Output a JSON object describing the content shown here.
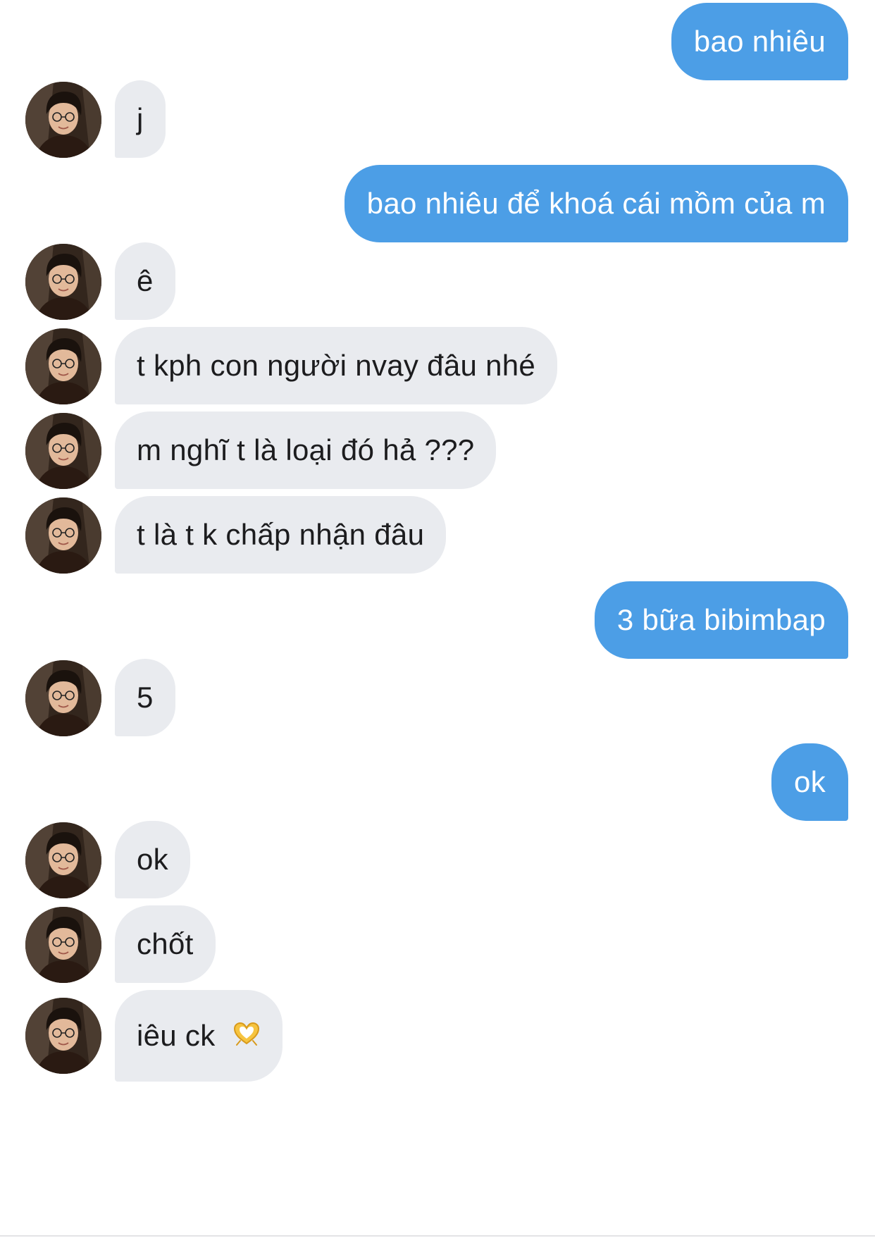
{
  "conversation": {
    "messages": [
      {
        "sender": "me",
        "text": "bao nhiêu"
      },
      {
        "sender": "them",
        "text": "j"
      },
      {
        "sender": "me",
        "text": "bao nhiêu để khoá cái mồm của m"
      },
      {
        "sender": "them",
        "text": "ê"
      },
      {
        "sender": "them",
        "text": "t kph con người nvay đâu nhé"
      },
      {
        "sender": "them",
        "text": "m nghĩ t là loại đó hả ???"
      },
      {
        "sender": "them",
        "text": "t là t k chấp nhận đâu"
      },
      {
        "sender": "me",
        "text": "3 bữa bibimbap"
      },
      {
        "sender": "them",
        "text": "5"
      },
      {
        "sender": "me",
        "text": "ok"
      },
      {
        "sender": "them",
        "text": "ok"
      },
      {
        "sender": "them",
        "text": "chốt"
      },
      {
        "sender": "them",
        "text": "iêu ck",
        "emoji": "heart-hands"
      }
    ]
  },
  "colors": {
    "outgoing_bubble": "#4c9ee6",
    "incoming_bubble": "#e9ebef",
    "outgoing_text": "#ffffff",
    "incoming_text": "#1c1c1e"
  }
}
